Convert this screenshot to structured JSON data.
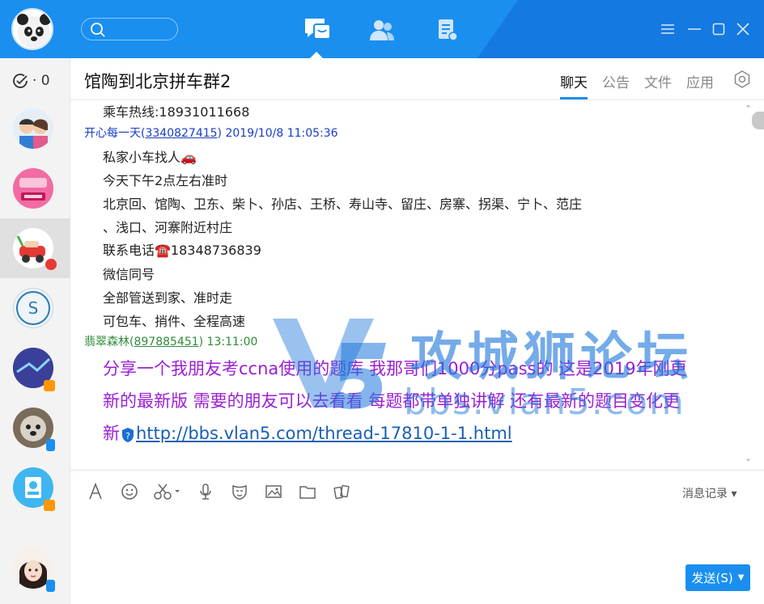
{
  "colors": {
    "accent": "#1a8ff0",
    "purple_text": "#9b1fd4",
    "blue_user": "#1a3ec4",
    "green_user": "#2e8b3a"
  },
  "sidebar": {
    "status_count": "· 0"
  },
  "chat": {
    "title": "馆陶到北京拼车群2",
    "tabs": [
      "聊天",
      "公告",
      "文件",
      "应用"
    ]
  },
  "messages": {
    "hotline": "乘车热线:18931011668",
    "msg1": {
      "sender": "开心每一天(",
      "uid": "3340827415",
      "close": ")",
      "time": " 2019/10/8 11:05:36"
    },
    "msg1_lines": [
      "私家小车找人🚗",
      "今天下午2点左右准时",
      "北京回、馆陶、卫东、柴卜、孙店、王桥、寿山寺、留庄、房寨、拐渠、宁卜、范庄",
      "、浅口、河寨附近村庄",
      "联系电话☎️18348736839",
      "微信同号",
      "全部管送到家、准时走",
      "可包车、捎件、全程高速"
    ],
    "msg2": {
      "sender": "翡翠森林(",
      "uid": "897885451",
      "close": ")",
      "time": "  13:11:00"
    },
    "msg2_lines": [
      "分享一个我朋友考ccna使用的题库 我那哥们1000分pass的 这是2019年刚更",
      "新的最新版 需要的朋友可以去看看 每题都带单独讲解 还有最新的题目变化更"
    ],
    "msg2_last_prefix": "新",
    "msg2_link": "http://bbs.vlan5.com/thread-17810-1-1.html"
  },
  "watermark": {
    "cn": "攻城狮论坛",
    "en": "bbs.vlan5.com"
  },
  "input": {
    "history_label": "消息记录",
    "send_label": "发送(S)"
  }
}
